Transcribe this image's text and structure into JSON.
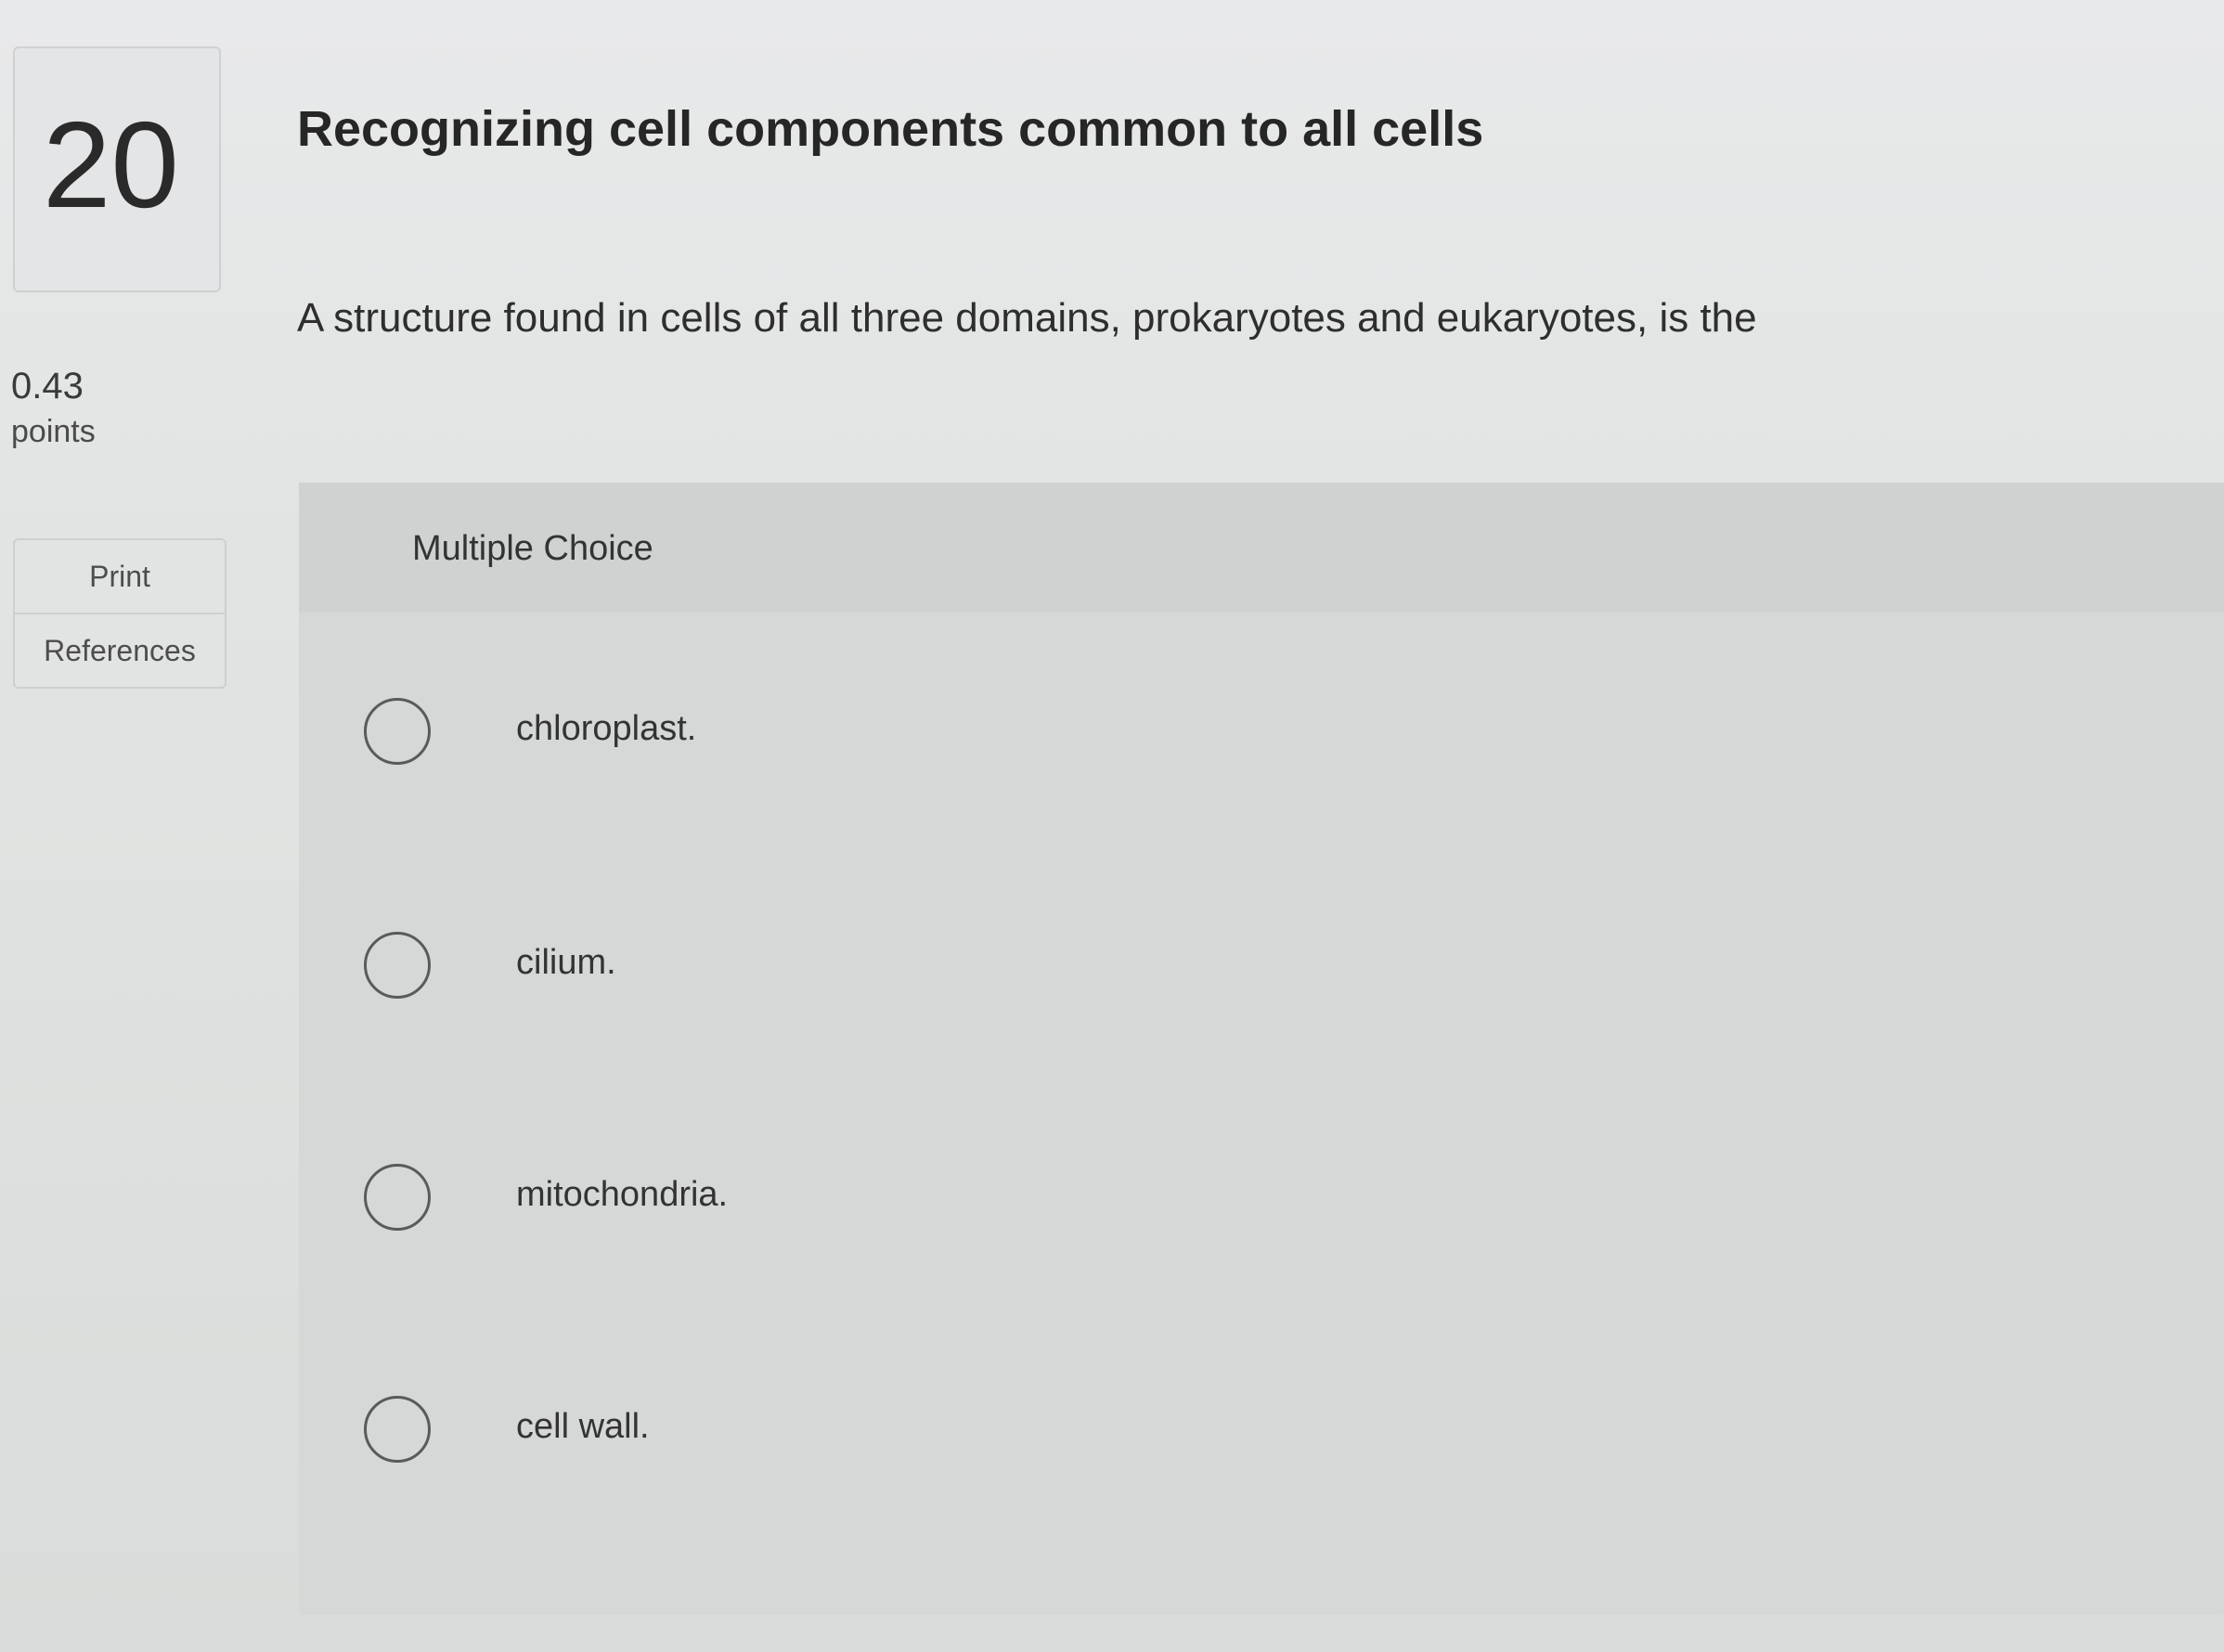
{
  "question": {
    "number": "20",
    "points_value": "0.43",
    "points_label": "points",
    "title": "Recognizing cell components common to all cells",
    "prompt": "A structure found in cells of all three domains, prokaryotes and eukaryotes, is the"
  },
  "sidebar": {
    "print_label": "Print",
    "references_label": "References"
  },
  "multiple_choice": {
    "label": "Multiple Choice",
    "options": [
      {
        "label": "chloroplast."
      },
      {
        "label": "cilium."
      },
      {
        "label": "mitochondria."
      },
      {
        "label": "cell wall."
      }
    ]
  }
}
